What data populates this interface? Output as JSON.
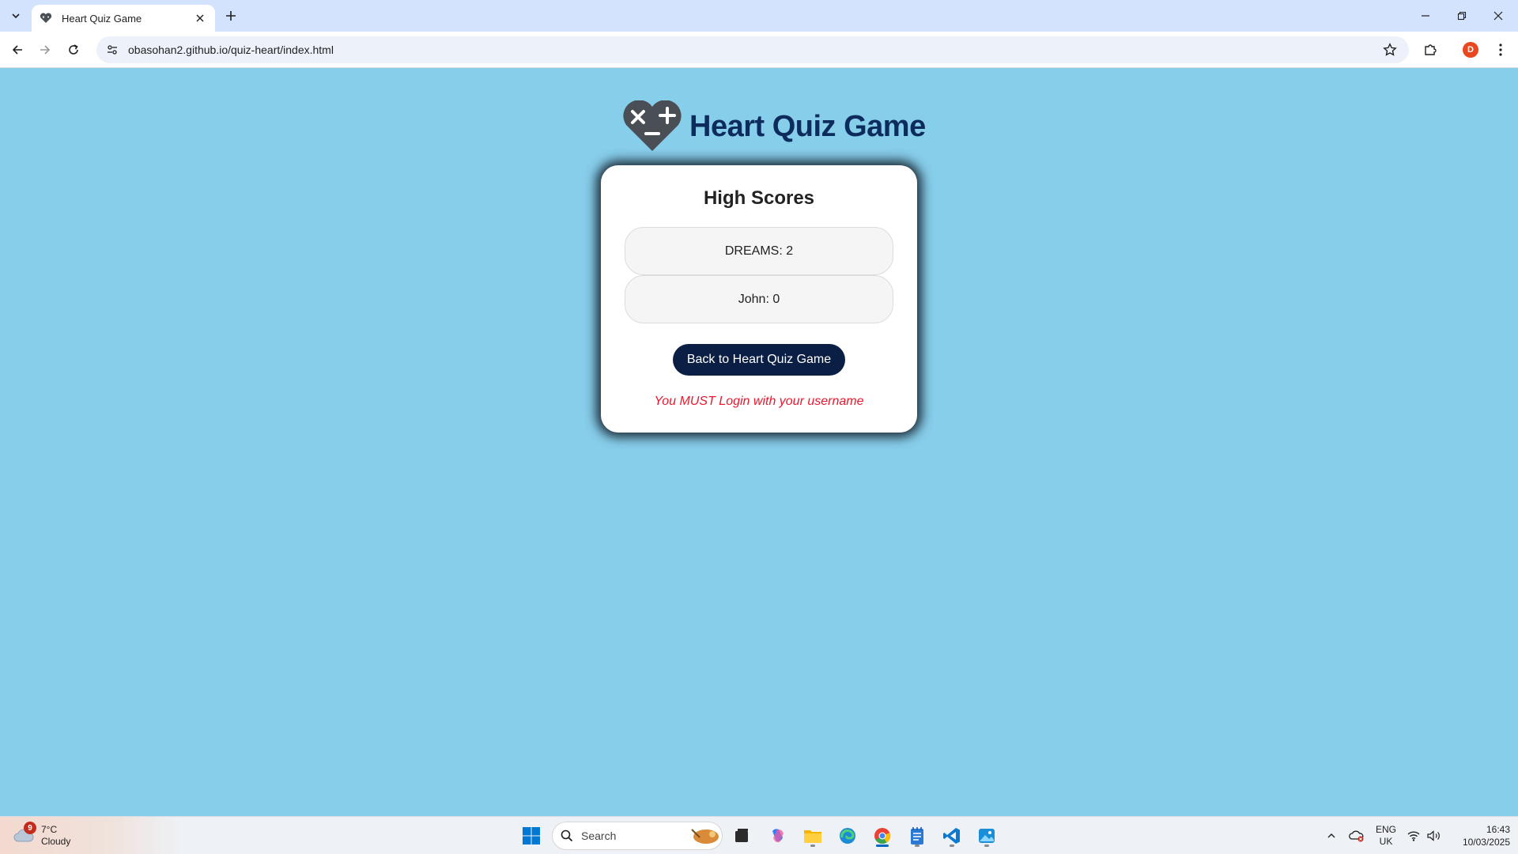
{
  "browser": {
    "tab_title": "Heart Quiz Game",
    "url": "obasohan2.github.io/quiz-heart/index.html",
    "profile_initial": "D"
  },
  "page": {
    "app_title": "Heart Quiz Game",
    "card_title": "High Scores",
    "scores": [
      {
        "label": "DREAMS: 2"
      },
      {
        "label": "John: 0"
      }
    ],
    "back_button": "Back to Heart Quiz Game",
    "warning": "You MUST Login with your username"
  },
  "taskbar": {
    "weather_temp": "7°C",
    "weather_desc": "Cloudy",
    "weather_badge": "9",
    "search_label": "Search",
    "lang_top": "ENG",
    "lang_bottom": "UK",
    "time": "16:43",
    "date": "10/03/2025"
  },
  "colors": {
    "page_background": "#87ceeb",
    "title_color": "#0d2b5c",
    "button_background": "#0b1f45",
    "warning_color": "#e8182d"
  }
}
